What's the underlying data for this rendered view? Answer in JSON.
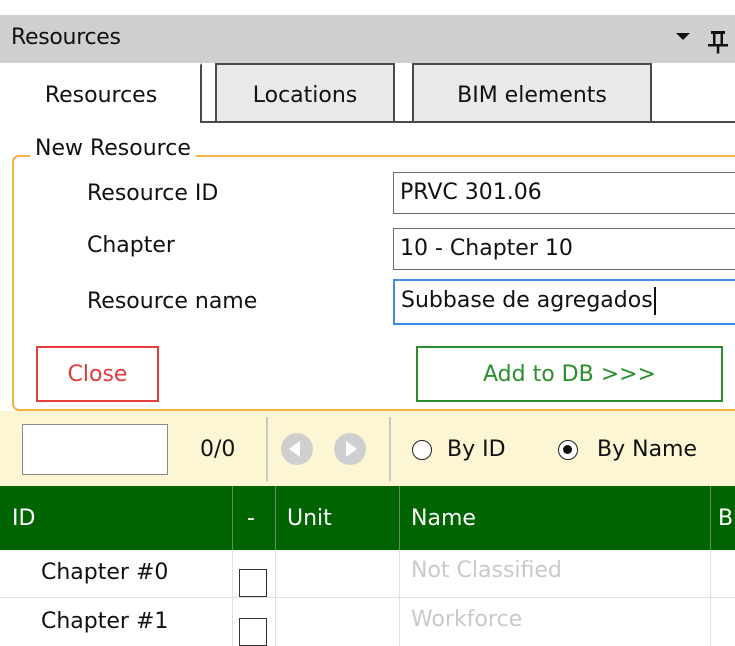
{
  "panel": {
    "title": "Resources"
  },
  "tabs": [
    {
      "label": "Resources",
      "active": true
    },
    {
      "label": "Locations",
      "active": false
    },
    {
      "label": "BIM elements",
      "active": false
    }
  ],
  "new_resource": {
    "legend": "New Resource",
    "resource_id_label": "Resource ID",
    "resource_id_value": "PRVC 301.06",
    "chapter_label": "Chapter",
    "chapter_value": "10 - Chapter 10",
    "resource_name_label": "Resource name",
    "resource_name_value": "Subbase de agregados",
    "close_label": "Close",
    "add_label": "Add to DB >>>"
  },
  "navigator": {
    "count": "0/0",
    "radio_by_id": "By ID",
    "radio_by_name": "By Name",
    "selected": "By Name"
  },
  "grid": {
    "columns": [
      "ID",
      "-",
      "Unit",
      "Name",
      "B"
    ],
    "rows": [
      {
        "id": "Chapter #0",
        "checked": false,
        "unit": "",
        "name": "Not Classified"
      },
      {
        "id": "Chapter #1",
        "checked": false,
        "unit": "",
        "name": "Workforce"
      }
    ]
  },
  "colors": {
    "header_green": "#006400",
    "group_border": "#f4b242",
    "close_red": "#e63c3c",
    "add_green": "#2e8b2e",
    "focus_blue": "#3e8ee6",
    "navbar_bg": "#fdf6d5"
  }
}
